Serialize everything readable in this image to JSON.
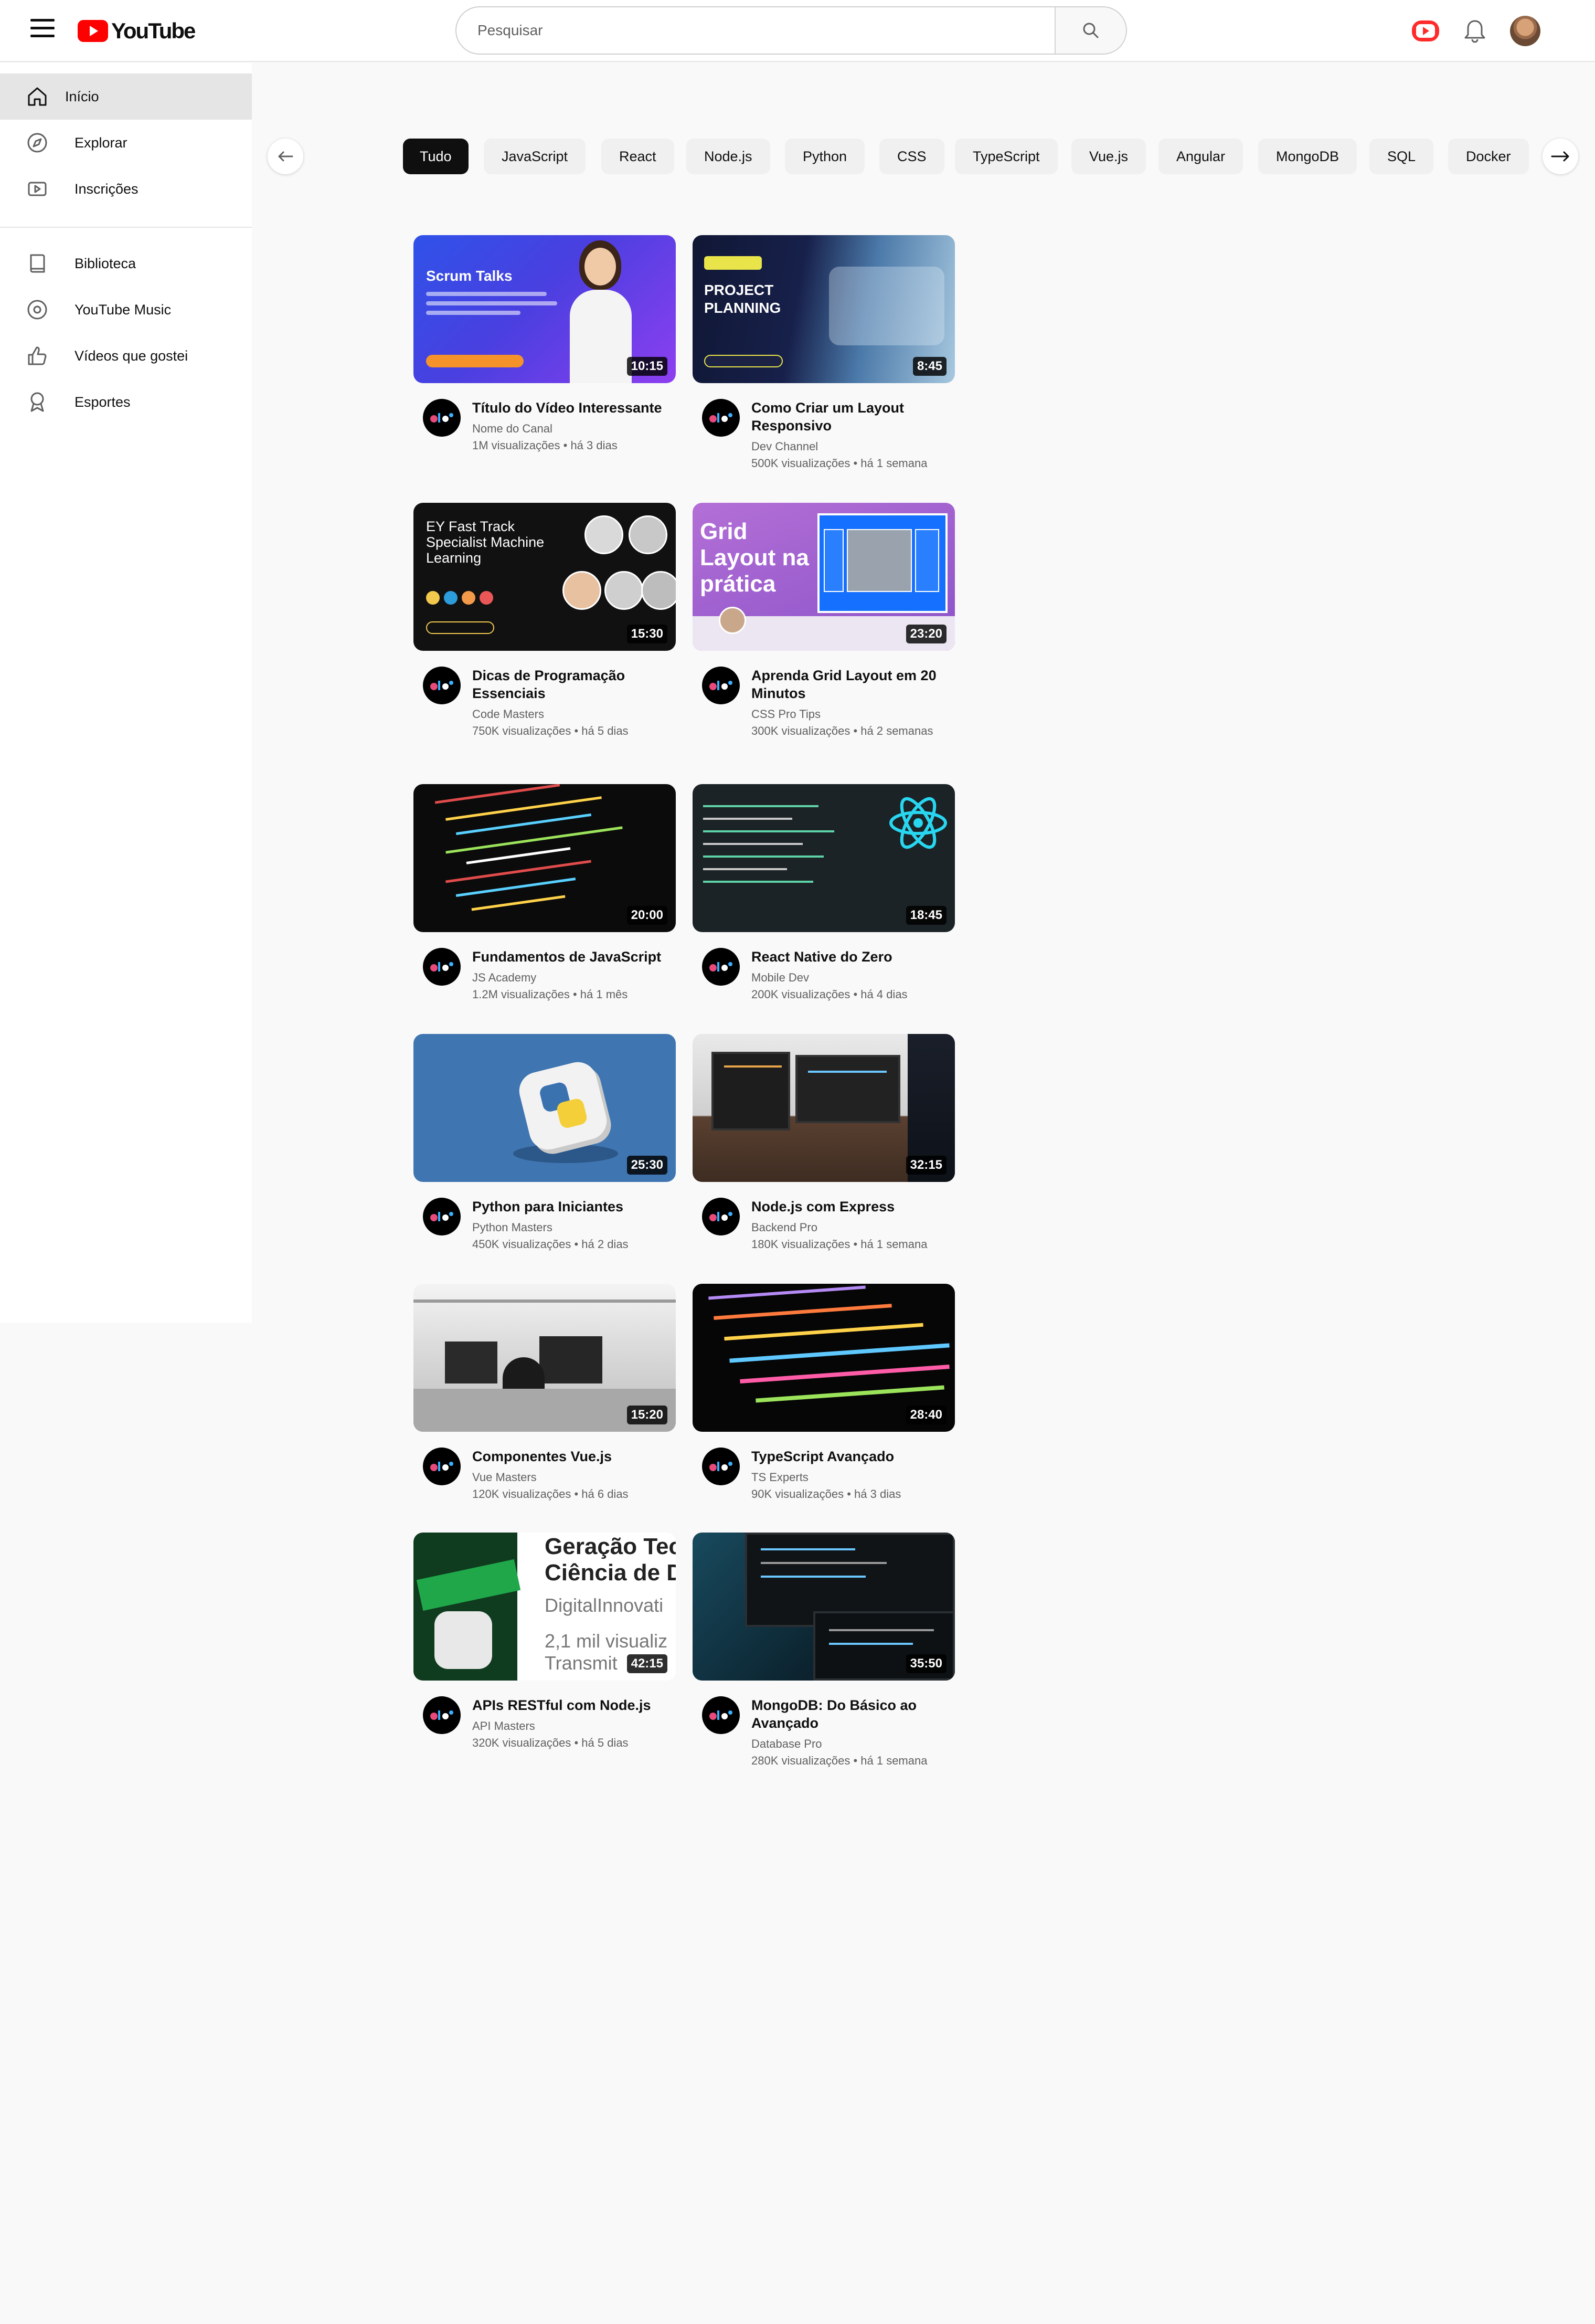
{
  "header": {
    "logo_text": "YouTube",
    "search_placeholder": "Pesquisar"
  },
  "sidebar": {
    "items": [
      {
        "label": "Início"
      },
      {
        "label": "Explorar"
      },
      {
        "label": "Inscrições"
      },
      {
        "label": "Biblioteca"
      },
      {
        "label": "YouTube Music"
      },
      {
        "label": "Vídeos que gostei"
      },
      {
        "label": "Esportes"
      }
    ]
  },
  "chips": [
    "Tudo",
    "JavaScript",
    "React",
    "Node.js",
    "Python",
    "CSS",
    "TypeScript",
    "Vue.js",
    "Angular",
    "MongoDB",
    "SQL",
    "Docker"
  ],
  "thumb_text": {
    "scrum_title": "Scrum Talks",
    "project_title": "PROJECT PLANNING",
    "ey_title": "EY Fast Track Specialist Machine Learning",
    "grid_title": "Grid Layout na prática",
    "geracao_l1": "Geração Tec",
    "geracao_l2": "Ciência de D",
    "geracao_l3": "DigitalInnovati",
    "geracao_l4": "2,1 mil visualiz",
    "geracao_l5": "Transmit"
  },
  "videos": [
    {
      "title": "Título do Vídeo Interessante",
      "channel": "Nome do Canal",
      "stats": "1M visualizações • há 3 dias",
      "duration": "10:15"
    },
    {
      "title": "Como Criar um Layout Responsivo",
      "channel": "Dev Channel",
      "stats": "500K visualizações • há 1 semana",
      "duration": "8:45"
    },
    {
      "title": "Dicas de Programação Essenciais",
      "channel": "Code Masters",
      "stats": "750K visualizações • há 5 dias",
      "duration": "15:30"
    },
    {
      "title": "Aprenda Grid Layout em 20 Minutos",
      "channel": "CSS Pro Tips",
      "stats": "300K visualizações • há 2 semanas",
      "duration": "23:20"
    },
    {
      "title": "Fundamentos de JavaScript",
      "channel": "JS Academy",
      "stats": "1.2M visualizações • há 1 mês",
      "duration": "20:00"
    },
    {
      "title": "React Native do Zero",
      "channel": "Mobile Dev",
      "stats": "200K visualizações • há 4 dias",
      "duration": "18:45"
    },
    {
      "title": "Python para Iniciantes",
      "channel": "Python Masters",
      "stats": "450K visualizações • há 2 dias",
      "duration": "25:30"
    },
    {
      "title": "Node.js com Express",
      "channel": "Backend Pro",
      "stats": "180K visualizações • há 1 semana",
      "duration": "32:15"
    },
    {
      "title": "Componentes Vue.js",
      "channel": "Vue Masters",
      "stats": "120K visualizações • há 6 dias",
      "duration": "15:20"
    },
    {
      "title": "TypeScript Avançado",
      "channel": "TS Experts",
      "stats": "90K visualizações • há 3 dias",
      "duration": "28:40"
    },
    {
      "title": "APIs RESTful com Node.js",
      "channel": "API Masters",
      "stats": "320K visualizações • há 5 dias",
      "duration": "42:15"
    },
    {
      "title": "MongoDB: Do Básico ao Avançado",
      "channel": "Database Pro",
      "stats": "280K visualizações • há 1 semana",
      "duration": "35:50"
    }
  ]
}
